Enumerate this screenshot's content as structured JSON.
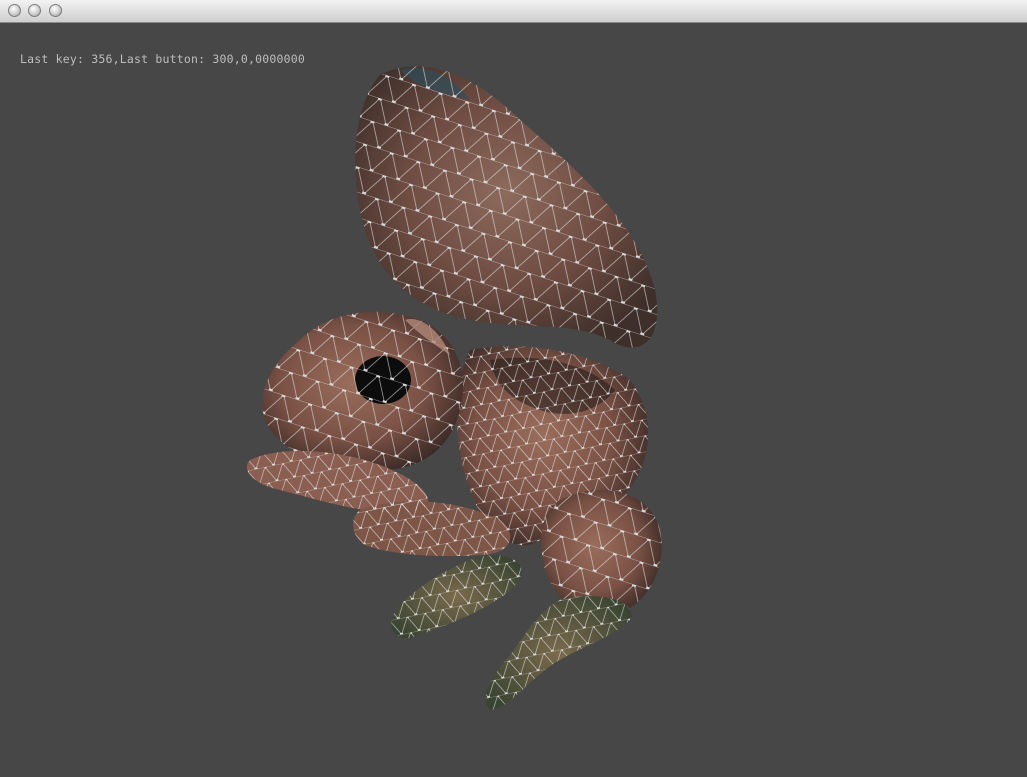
{
  "window": {
    "controls": [
      {
        "name": "close",
        "icon": "close-dot-icon"
      },
      {
        "name": "minimize",
        "icon": "minimize-dot-icon"
      },
      {
        "name": "zoom",
        "icon": "zoom-dot-icon"
      }
    ]
  },
  "viewport": {
    "status_text": "Last key: 356,Last button: 300,0,0000000",
    "background_color": "#474747",
    "model": "textured-squirrel-mesh-with-wireframe"
  }
}
